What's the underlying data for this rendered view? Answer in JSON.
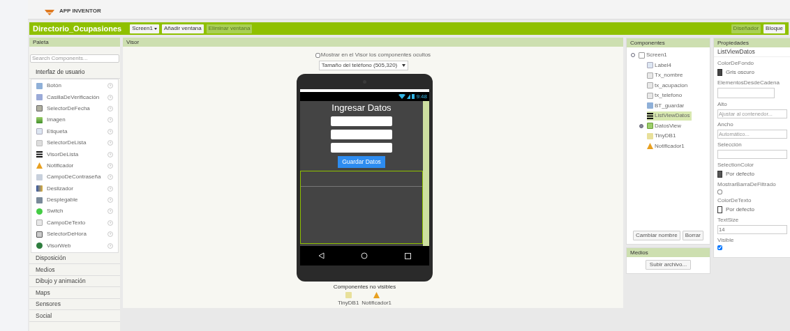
{
  "header": {
    "app_name": "APP INVENTOR"
  },
  "toolbar": {
    "project": "Directorio_Ocupasiones",
    "screen": "Screen1",
    "buttons": [
      {
        "label": "Añadir ventana",
        "disabled": false
      },
      {
        "label": "Eliminar ventana",
        "disabled": true
      }
    ],
    "views": [
      {
        "label": "Diseñador",
        "selected": true
      },
      {
        "label": "Bloque",
        "selected": false
      }
    ]
  },
  "palette": {
    "title": "Paleta",
    "search_placeholder": "Search Components...",
    "open_group": "Interfaz de usuario",
    "items": [
      {
        "label": "Botón",
        "kind": "button"
      },
      {
        "label": "CasillaDeVerificación",
        "kind": "checkbox"
      },
      {
        "label": "SelectorDeFecha",
        "kind": "date"
      },
      {
        "label": "Imagen",
        "kind": "image"
      },
      {
        "label": "Etiqueta",
        "kind": "label"
      },
      {
        "label": "SelectorDeLista",
        "kind": "listpicker"
      },
      {
        "label": "VisorDeLista",
        "kind": "listview"
      },
      {
        "label": "Notificador",
        "kind": "notifier"
      },
      {
        "label": "CampoDeContraseña",
        "kind": "password"
      },
      {
        "label": "Deslizador",
        "kind": "slider"
      },
      {
        "label": "Desplegable",
        "kind": "spinner"
      },
      {
        "label": "Switch",
        "kind": "switch"
      },
      {
        "label": "CampoDeTexto",
        "kind": "textbox"
      },
      {
        "label": "SelectorDeHora",
        "kind": "time"
      },
      {
        "label": "VisorWeb",
        "kind": "web"
      }
    ],
    "groups": [
      "Disposición",
      "Medios",
      "Dibujo y animación",
      "Maps",
      "Sensores",
      "Social"
    ]
  },
  "viewer": {
    "title": "Visor",
    "show_hidden": {
      "label": "Mostrar en el Visor los componentes ocultos",
      "checked": false
    },
    "size_select": "Tamaño del teléfono (505,320)",
    "phone": {
      "time": "9:48",
      "title": "Ingresar Datos",
      "fields": [
        {
          "kind": "textbox"
        },
        {
          "kind": "textbox"
        },
        {
          "kind": "textbox"
        }
      ],
      "button": "Guardar Datos"
    },
    "nonvisible_title": "Componentes no visibles",
    "nonvisible": [
      {
        "label": "TinyDB1",
        "kind": "db"
      },
      {
        "label": "Notificador1",
        "kind": "notifier"
      }
    ]
  },
  "components": {
    "title": "Componentes",
    "tree": [
      {
        "label": "Screen1",
        "kind": "screen",
        "expanded": true,
        "selected": false,
        "children": [
          {
            "label": "Label4",
            "kind": "label",
            "selected": false
          },
          {
            "label": "Tx_nombre",
            "kind": "textbox",
            "selected": false
          },
          {
            "label": "tx_acupacion",
            "kind": "textbox",
            "selected": false
          },
          {
            "label": "tx_telefono",
            "kind": "textbox",
            "selected": false
          },
          {
            "label": "BT_guardar",
            "kind": "button",
            "selected": false
          },
          {
            "label": "ListViewDatos",
            "kind": "listview",
            "selected": true
          },
          {
            "label": "DatosView",
            "kind": "arrangement",
            "expanded": false,
            "selected": false
          },
          {
            "label": "TinyDB1",
            "kind": "db",
            "selected": false
          },
          {
            "label": "Notificador1",
            "kind": "notifier",
            "selected": false
          }
        ]
      }
    ],
    "buttons": [
      "Cambiar nombre",
      "Borrar"
    ]
  },
  "media": {
    "title": "Medios",
    "button": "Subir archivo..."
  },
  "properties": {
    "title": "Propiedades",
    "component": "ListViewDatos",
    "items": [
      {
        "label": "ColorDeFondo",
        "kind": "color",
        "value": "Gris oscuro",
        "color": "#444444"
      },
      {
        "label": "ElementosDesdeCadena",
        "kind": "textarea"
      },
      {
        "label": "Alto",
        "kind": "text",
        "placeholder": "Ajustar al contenedor..."
      },
      {
        "label": "Ancho",
        "kind": "text",
        "placeholder": "Automático..."
      },
      {
        "label": "Selección",
        "kind": "text"
      },
      {
        "label": "SelectionColor",
        "kind": "color",
        "value": "Por defecto",
        "color": "#555555"
      },
      {
        "label": "MostrarBarraDeFiltrado",
        "kind": "checkbox",
        "checked": false
      },
      {
        "label": "ColorDeTexto",
        "kind": "color",
        "value": "Por defecto",
        "color": "#ffffff"
      },
      {
        "label": "TextSize",
        "kind": "text",
        "value": "14"
      },
      {
        "label": "Visible",
        "kind": "checkbox",
        "checked": true
      }
    ]
  }
}
